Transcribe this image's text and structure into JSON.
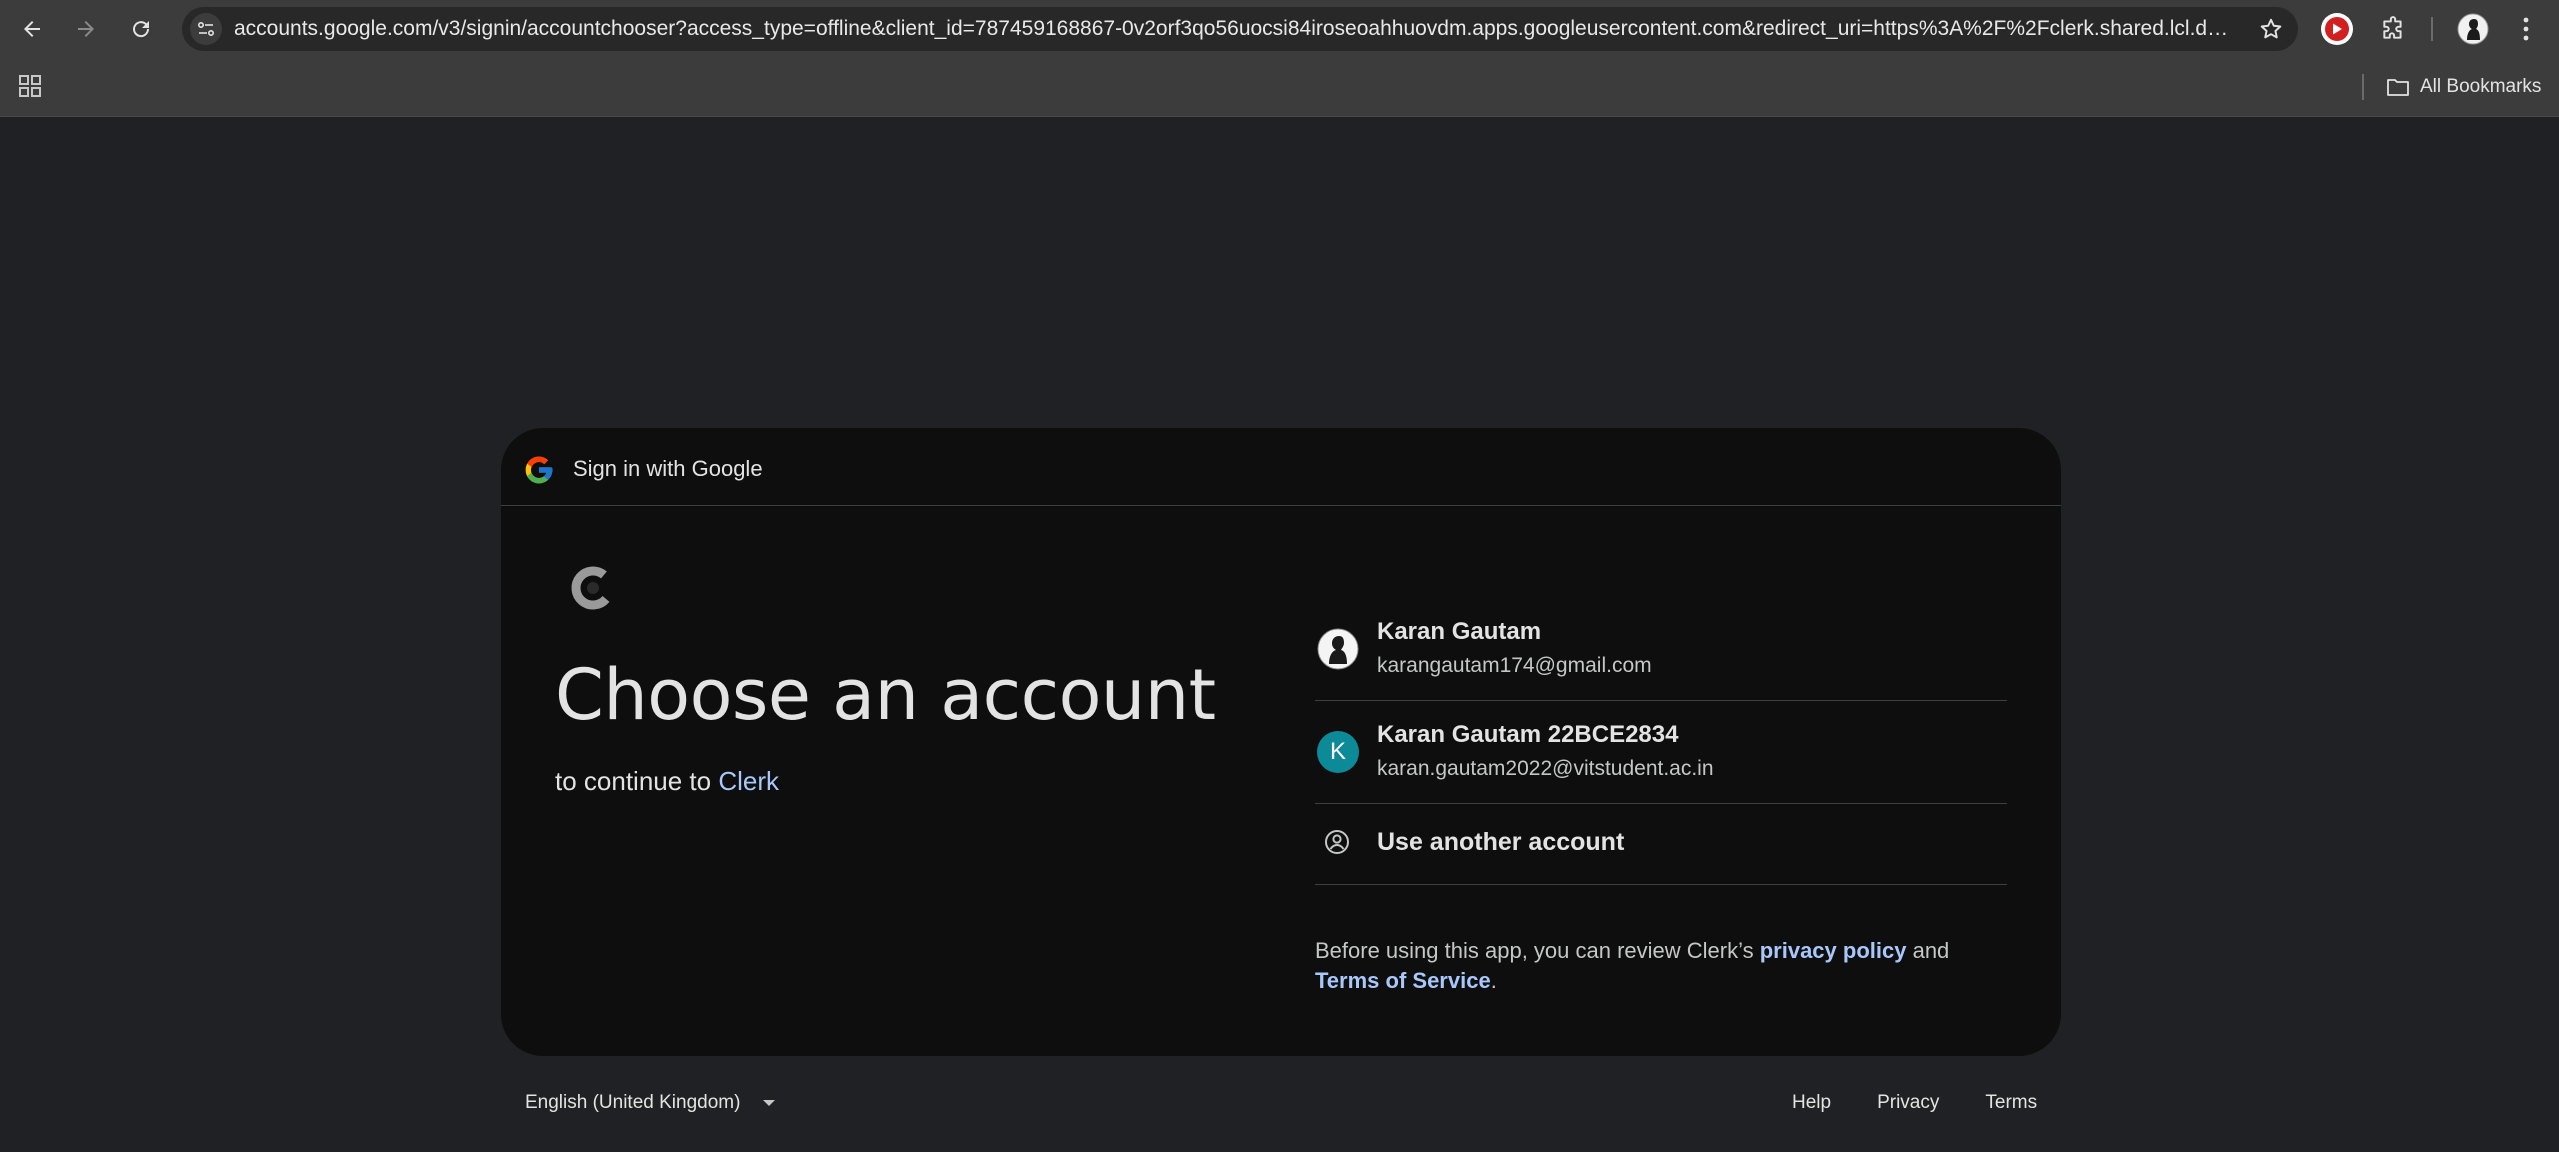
{
  "browser": {
    "url": "accounts.google.com/v3/signin/accountchooser?access_type=offline&client_id=787459168867-0v2orf3qo56uocsi84iroseoahhuovdm.apps.googleusercontent.com&redirect_uri=https%3A%2F%2Fclerk.shared.lcl.dev...",
    "all_bookmarks": "All Bookmarks",
    "icons": [
      "back-icon",
      "forward-icon",
      "reload-icon",
      "site-info-icon",
      "bookmark-star-icon",
      "youtube-extension-icon",
      "extensions-puzzle-icon",
      "profile-avatar",
      "menu-dots-icon",
      "apps-grid-icon",
      "folder-icon"
    ]
  },
  "card": {
    "header": "Sign in with Google",
    "heading": "Choose an account",
    "subtitle_prefix": "to continue to ",
    "app_name": "Clerk",
    "accounts": [
      {
        "name": "Karan Gautam",
        "email": "karangautam174@gmail.com",
        "avatar": "photo"
      },
      {
        "name": "Karan Gautam 22BCE2834",
        "email": "karan.gautam2022@vitstudent.ac.in",
        "avatar_letter": "K",
        "avatar_color": "#0d8a98"
      }
    ],
    "use_another": "Use another account",
    "disclaimer": {
      "text1": "Before using this app, you can review Clerk’s ",
      "privacy": "privacy policy",
      "text2": " and ",
      "terms": "Terms of Service",
      "text3": "."
    }
  },
  "footer": {
    "language": "English (United Kingdom)",
    "help": "Help",
    "privacy": "Privacy",
    "terms": "Terms"
  },
  "colors": {
    "page_bg": "#202124",
    "card_bg": "#0e0e0e",
    "link": "#a8c7fa",
    "chrome": "#3c3c3c"
  }
}
